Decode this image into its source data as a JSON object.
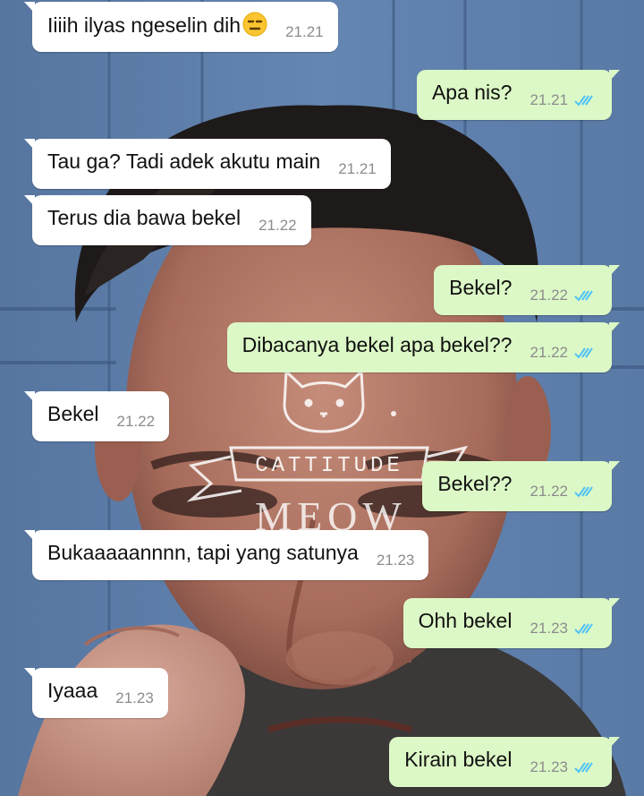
{
  "colors": {
    "incoming_bubble": "#ffffff",
    "outgoing_bubble": "#dcf8c6",
    "read_tick": "#4fc3f7",
    "timestamp": "#8c8c8c"
  },
  "watermark": {
    "badge": "CATTITUDE",
    "script": "MEOW"
  },
  "messages": [
    {
      "direction": "in",
      "text": "Iiiih ilyas ngeselin dih",
      "emoji": "expressionless-face",
      "time": "21.21"
    },
    {
      "direction": "out",
      "text": "Apa nis?",
      "time": "21.21",
      "status": "read"
    },
    {
      "direction": "in",
      "text": "Tau ga? Tadi adek akutu main",
      "time": "21.21"
    },
    {
      "direction": "in",
      "text": "Terus dia bawa bekel",
      "time": "21.22"
    },
    {
      "direction": "out",
      "text": "Bekel?",
      "time": "21.22",
      "status": "read"
    },
    {
      "direction": "out",
      "text": "Dibacanya bekel apa bekel??",
      "time": "21.22",
      "status": "read"
    },
    {
      "direction": "in",
      "text": "Bekel",
      "time": "21.22"
    },
    {
      "direction": "out",
      "text": "Bekel??",
      "time": "21.22",
      "status": "read"
    },
    {
      "direction": "in",
      "text": "Bukaaaaannnn, tapi yang satunya",
      "time": "21.23"
    },
    {
      "direction": "out",
      "text": "Ohh bekel",
      "time": "21.23",
      "status": "read"
    },
    {
      "direction": "in",
      "text": "Iyaaa",
      "time": "21.23"
    },
    {
      "direction": "out",
      "text": "Kirain bekel",
      "time": "21.23",
      "status": "read"
    }
  ]
}
